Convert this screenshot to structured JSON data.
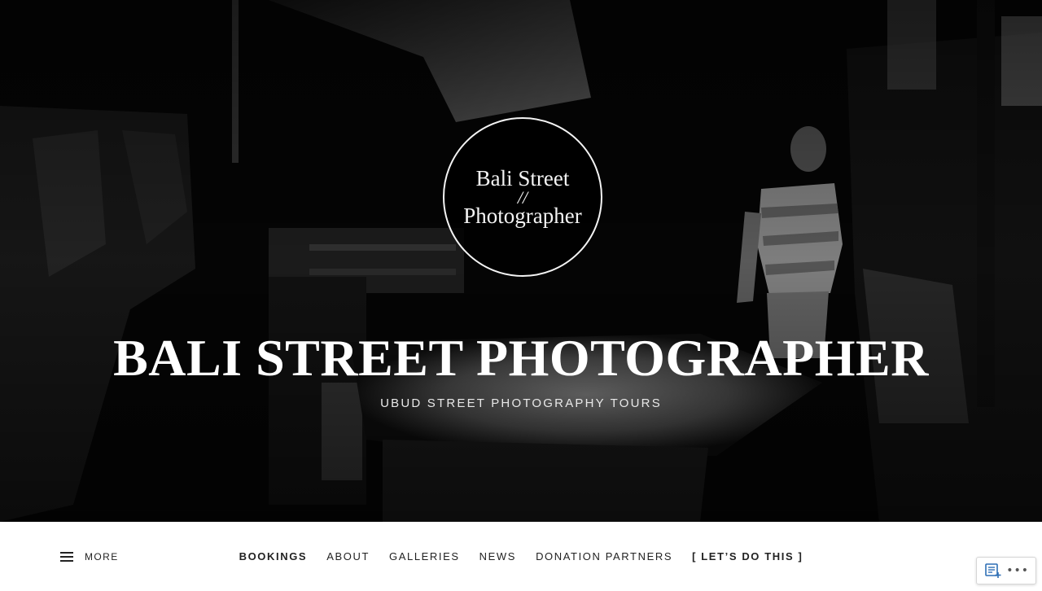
{
  "hero": {
    "logo": {
      "line1": "Bali Street",
      "line2": "//",
      "line3": "Photographer"
    },
    "site_title": "BALI STREET PHOTOGRAPHER",
    "tagline": "UBUD STREET PHOTOGRAPHY TOURS"
  },
  "nav": {
    "more_label": "MORE",
    "more_icon": "menu-icon",
    "items": [
      {
        "label": "BOOKINGS",
        "bold": true
      },
      {
        "label": "ABOUT",
        "bold": false
      },
      {
        "label": "GALLERIES",
        "bold": false
      },
      {
        "label": "NEWS",
        "bold": false
      },
      {
        "label": "DONATION PARTNERS",
        "bold": false
      },
      {
        "label": "[ LET’S DO THIS ]",
        "bold": true
      }
    ]
  },
  "widget": {
    "reader_icon": "reader-follow-icon",
    "more_icon": "ellipsis-icon",
    "more_glyph": "•••"
  },
  "colors": {
    "hero_bg": "#050505",
    "nav_bg": "#ffffff",
    "nav_text": "#222222",
    "reader_icon": "#2e6fb5"
  }
}
